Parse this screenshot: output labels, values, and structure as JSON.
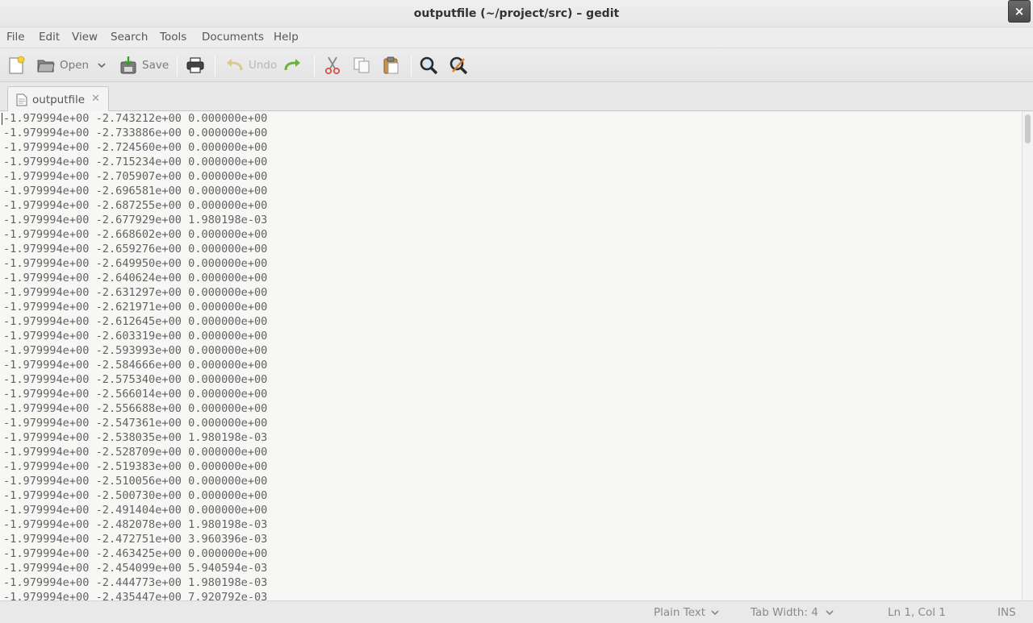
{
  "window": {
    "title": "outputfile (~/project/src) – gedit",
    "close_glyph": "×"
  },
  "menu": [
    "File",
    "Edit",
    "View",
    "Search",
    "Tools",
    "Documents",
    "Help"
  ],
  "toolbar": {
    "open_label": "Open",
    "save_label": "Save",
    "undo_label": "Undo"
  },
  "tab": {
    "label": "outputfile",
    "close_glyph": "✕"
  },
  "lines": [
    "-1.979994e+00 -2.743212e+00 0.000000e+00",
    "-1.979994e+00 -2.733886e+00 0.000000e+00",
    "-1.979994e+00 -2.724560e+00 0.000000e+00",
    "-1.979994e+00 -2.715234e+00 0.000000e+00",
    "-1.979994e+00 -2.705907e+00 0.000000e+00",
    "-1.979994e+00 -2.696581e+00 0.000000e+00",
    "-1.979994e+00 -2.687255e+00 0.000000e+00",
    "-1.979994e+00 -2.677929e+00 1.980198e-03",
    "-1.979994e+00 -2.668602e+00 0.000000e+00",
    "-1.979994e+00 -2.659276e+00 0.000000e+00",
    "-1.979994e+00 -2.649950e+00 0.000000e+00",
    "-1.979994e+00 -2.640624e+00 0.000000e+00",
    "-1.979994e+00 -2.631297e+00 0.000000e+00",
    "-1.979994e+00 -2.621971e+00 0.000000e+00",
    "-1.979994e+00 -2.612645e+00 0.000000e+00",
    "-1.979994e+00 -2.603319e+00 0.000000e+00",
    "-1.979994e+00 -2.593993e+00 0.000000e+00",
    "-1.979994e+00 -2.584666e+00 0.000000e+00",
    "-1.979994e+00 -2.575340e+00 0.000000e+00",
    "-1.979994e+00 -2.566014e+00 0.000000e+00",
    "-1.979994e+00 -2.556688e+00 0.000000e+00",
    "-1.979994e+00 -2.547361e+00 0.000000e+00",
    "-1.979994e+00 -2.538035e+00 1.980198e-03",
    "-1.979994e+00 -2.528709e+00 0.000000e+00",
    "-1.979994e+00 -2.519383e+00 0.000000e+00",
    "-1.979994e+00 -2.510056e+00 0.000000e+00",
    "-1.979994e+00 -2.500730e+00 0.000000e+00",
    "-1.979994e+00 -2.491404e+00 0.000000e+00",
    "-1.979994e+00 -2.482078e+00 1.980198e-03",
    "-1.979994e+00 -2.472751e+00 3.960396e-03",
    "-1.979994e+00 -2.463425e+00 0.000000e+00",
    "-1.979994e+00 -2.454099e+00 5.940594e-03",
    "-1.979994e+00 -2.444773e+00 1.980198e-03",
    "-1.979994e+00 -2.435447e+00 7.920792e-03"
  ],
  "status": {
    "language": "Plain Text",
    "tab_width": "Tab Width:  4",
    "position": "Ln 1, Col 1",
    "mode": "INS"
  }
}
